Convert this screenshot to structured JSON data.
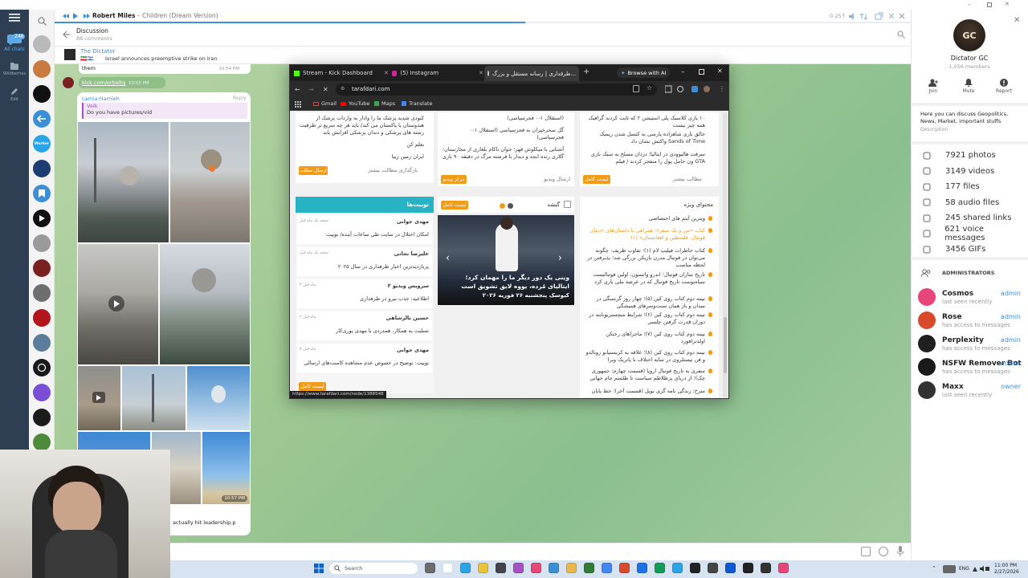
{
  "player": {
    "artist": "Robert Miles",
    "separator": "–",
    "track": "Children (Dream Version)",
    "speed": "0.25↑"
  },
  "discussion": {
    "title": "Discussion",
    "count": "88 comments"
  },
  "pinned": {
    "channel": "The Dictator",
    "message": "Israel announces preemptive strike on Iran",
    "flags": "🇮🇷🇮🇱"
  },
  "sidebar": {
    "unread": "246",
    "all_chats": "All chats",
    "folder2": "Wildberries",
    "edit": "Edit",
    "worker_label": "Worker"
  },
  "messages": {
    "them": "them",
    "them_time": "10:54 PM",
    "link": "kick.com/orbeltg",
    "link_time": "10:55 PM",
    "reply_author": "Lamia Hamieh",
    "reply_action": "Reply",
    "quote_author": "Veik",
    "quote_text": "Do you have pictures/vid",
    "album_time": "10:57 PM",
    "caption": "actually hit leadership.p"
  },
  "browser": {
    "tabs": [
      "Stream - Kick Dashboard",
      "(5) Instagram",
      "طرفداری | رسانه مستقل و بزرگ..."
    ],
    "ai_button": "Browse with AI",
    "url": "tarafdari.com",
    "bookmarks": [
      "Gmail",
      "YouTube",
      "Maps",
      "Translate"
    ],
    "status_url": "https://www.tarafdari.com/node/1388548"
  },
  "site": {
    "col1_items": [
      "کبودی شدید پزشک ما را وادار به واردات پزشک از هندوستان یا پاکستان می کند/ باید هر چه سریع تر ظرفیت رشته های پزشکی و دندان پزشکی افزایش یابد",
      "بغلم کن",
      "ایران زمین زیبا"
    ],
    "col1_more": "بازگذاری مطالب بیشتر",
    "col1_btn": "ارسال مطلب",
    "col2_items": [
      "(استقلال ۱-۰ فجرسپاسی)",
      "گل سحرخیزان به فجرسپاسی (استقلال ۱-۰ فجرسپاسی)",
      "آشنایی با میکلوش فهر؛ جوان ناکام بلغاری از مجارستان؛ گلاری زنده ابجد و دیدار با فرشته مرگ در دقیقه ۹۰ بازی"
    ],
    "col2_btn": "ارسال ویدیو",
    "col2_btn2": "مرکز ویدیو",
    "col3_items": [
      "۱۰ بازی کلاسیک پلی استیشن ۲ که ثابت کردند گرافیک همه چیز نیست",
      "خالق بازی شاهزاده پارسی به کنسل شدن ریمیک Sands of Time واکنش نشان داد",
      "سرقت هالیوودی در ایتالیا؛ دزدان مسلح به سبک بازی GTA ون حامل پول را منفجر کردند / فیلم"
    ],
    "col3_more": "مطالب بیشتر",
    "col3_btn": "لیست کامل",
    "tweets_title": "توییت‌ها",
    "tweets": [
      {
        "author": "مهدی جوانی",
        "time": "جمعه یک ماه قبل",
        "text": "امکان اختلال در سایت طی ساعات آینده/ توییت"
      },
      {
        "author": "علیرضا نجاتی",
        "time": "جمعه یک ماه قبل",
        "text": "پربازدیدترین اخبار طرفداری در سال ۲۰۲۵"
      },
      {
        "author": "سرویس ویدیو ۲",
        "time": "۳ ماه قبل",
        "text": "اطلاعیه: جذب نیرو در طرفداری"
      },
      {
        "author": "حسین بالرشاهی",
        "time": "۲ ماه قبل",
        "text": "تسلیت به همکار، همدردی با مهدی پوری‌کار"
      },
      {
        "author": "مهدی جوانی",
        "time": "۸ ماه قبل",
        "text": "توییت: توضیح در خصوص عدم مشاهده کامنت‌های ارسالی"
      }
    ],
    "tweets_btn": "لیست کامل",
    "gishe_title": "گیشه",
    "gishe_btn": "لیست کامل",
    "slide_text": "وینی یک دور دیگر ما را مهمان کرد؛ ایتالیای مُرده، یووه لایق تشویق است",
    "slide_sub": "کیوسک پنجشنبه ۲۶ فوریه ۲۰۲۶",
    "special_title": "محتوای ویژه",
    "special_items": [
      "ویترین آیتم های اختصاصی",
      "کتاب «من و یک سفر»؛ همراهی با داستان‌های «دنیای فوتبال، فلسطین و افغانستان» (۱)",
      "کتاب خاطرات فیلیپ لام (۱)؛ تفاوت ظریف: چگونه می‌توان در فوتبال مدرن بازیکن بزرگی شد؛ پذیرفتن در لحظه مناسب",
      "تاریخ سازان فوتبال؛ اندرو واتسون، اولین فوتبالیست سیاه‌پوست تاریخ فوتبال که در عرصه ملی بازی کرد",
      "نیمه دوم کتاب روی کین (۵)؛ چهار روز گرسنگی در میدان و باز همان سنت‌وسرهای همیشگی",
      "نیمه دوم کتاب روی کین (۶)؛ شرایط منچستریونایتد در دوران قدرت گرفتن چلسی",
      "نیمه دوم کتاب روی کین (۷)؛ ماجراهای رختکن اولدترافورد",
      "نیمه دوم کتاب روی کین (۸)؛ علاقه به کریستیانو رونالدو و فن نیستلروی در سایه اختلاف با پاتریک ویرا",
      "سفری به تاریخ فوتبال اروپا (قسمت چهارم: جمهوری چک)؛ از دریای پرطلاطم سیاست تا طلسم جام جهانی",
      "سرخ: زندگی نامه گری نویل (قسمت آخر)؛ خط پایان"
    ]
  },
  "profile": {
    "initials": "GC",
    "name": "Dictator GC",
    "members": "1,056 members",
    "actions": [
      "Join",
      "Mute",
      "Report"
    ],
    "description": "Here you can discuss Geopolitics, News, Market, important stuffs",
    "description_label": "Description"
  },
  "media": [
    {
      "icon": "photo-icon",
      "label": "7921 photos"
    },
    {
      "icon": "video-icon",
      "label": "3149 videos"
    },
    {
      "icon": "file-icon",
      "label": "177 files"
    },
    {
      "icon": "audio-icon",
      "label": "58 audio files"
    },
    {
      "icon": "link-icon",
      "label": "245 shared links"
    },
    {
      "icon": "mic-icon",
      "label": "621 voice messages"
    },
    {
      "icon": "gif-icon",
      "label": "3456 GIFs"
    }
  ],
  "administrators": {
    "title": "ADMINISTRATORS",
    "list": [
      {
        "name": "Cosmos",
        "status": "last seen recently",
        "role": "admin",
        "color": "#e8457a"
      },
      {
        "name": "Rose",
        "status": "has access to messages",
        "role": "admin",
        "color": "#d94a2a"
      },
      {
        "name": "Perplexity",
        "status": "has access to messages",
        "role": "admin",
        "color": "#1f1f1f"
      },
      {
        "name": "NSFW Remover Bot",
        "status": "has access to messages",
        "role": "admin",
        "color": "#1a1a1a"
      },
      {
        "name": "Maxx",
        "status": "last seen recently",
        "role": "owner",
        "color": "#333333"
      }
    ]
  },
  "taskbar": {
    "search": "Search",
    "lang": "ENG",
    "time": "11:00 PM",
    "date": "2/27/2026"
  }
}
